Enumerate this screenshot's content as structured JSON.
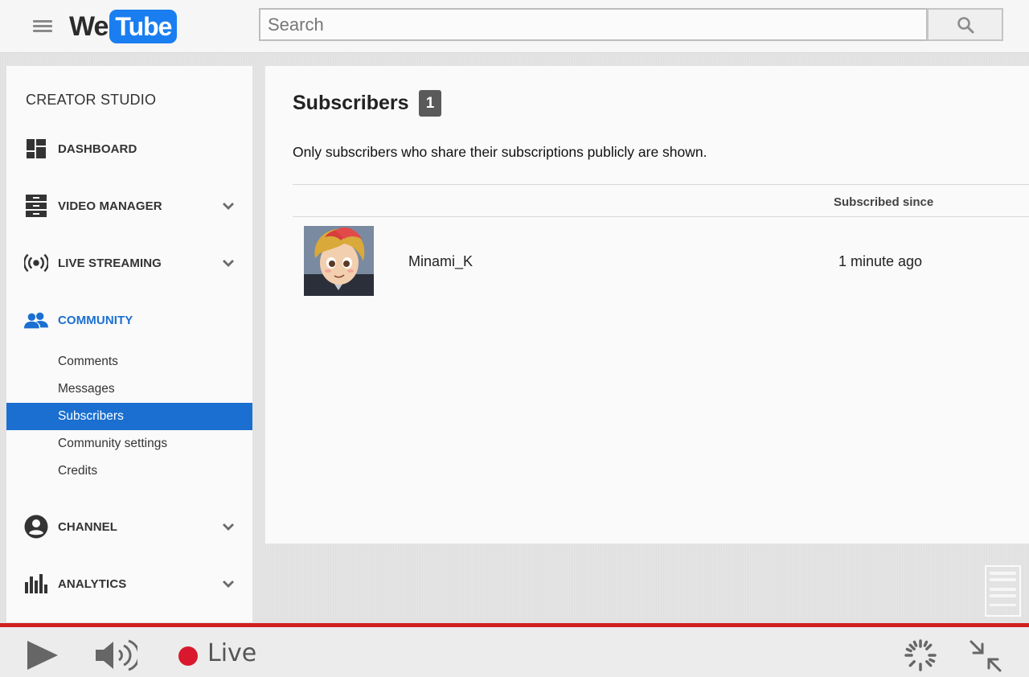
{
  "header": {
    "logo_we": "We",
    "logo_tube": "Tube",
    "search_placeholder": "Search"
  },
  "sidebar": {
    "title": "CREATOR STUDIO",
    "items": [
      {
        "label": "DASHBOARD",
        "icon": "dashboard-icon"
      },
      {
        "label": "VIDEO MANAGER",
        "icon": "video-manager-icon"
      },
      {
        "label": "LIVE STREAMING",
        "icon": "live-streaming-icon"
      },
      {
        "label": "COMMUNITY",
        "icon": "community-icon",
        "active": true
      },
      {
        "label": "CHANNEL",
        "icon": "channel-icon"
      },
      {
        "label": "ANALYTICS",
        "icon": "analytics-icon"
      }
    ],
    "community_sub": [
      {
        "label": "Comments"
      },
      {
        "label": "Messages"
      },
      {
        "label": "Subscribers",
        "selected": true
      },
      {
        "label": "Community settings"
      },
      {
        "label": "Credits"
      }
    ]
  },
  "main": {
    "title": "Subscribers",
    "count": "1",
    "notice": "Only subscribers who share their subscriptions publicly are shown.",
    "column_header": "Subscribed since",
    "subscribers": [
      {
        "name": "Minami_K",
        "since": "1 minute ago"
      }
    ]
  },
  "player": {
    "live_label": "Live"
  },
  "colors": {
    "accent": "#1a6fd1",
    "logo_blue": "#1a7ef0",
    "live_red": "#d9182d",
    "bar_red": "#cf1f1f"
  }
}
